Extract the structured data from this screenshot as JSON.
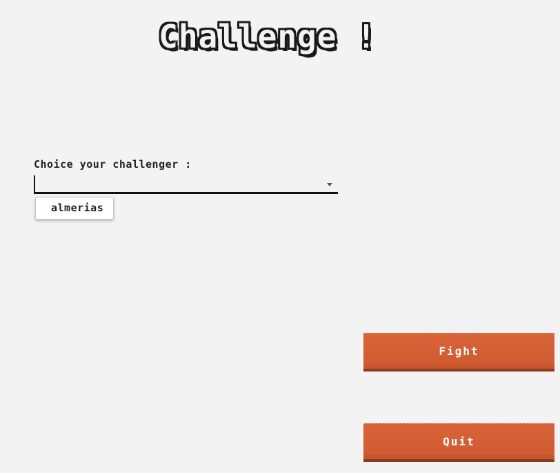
{
  "header": {
    "title": "Challenge !"
  },
  "challenger_select": {
    "label": "Choice your challenger :",
    "value": "",
    "options": [
      "almerias"
    ]
  },
  "actions": {
    "fight_label": "Fight",
    "quit_label": "Quit"
  },
  "colors": {
    "background": "#f3f3f3",
    "button": "#d9643a",
    "text": "#222222"
  }
}
